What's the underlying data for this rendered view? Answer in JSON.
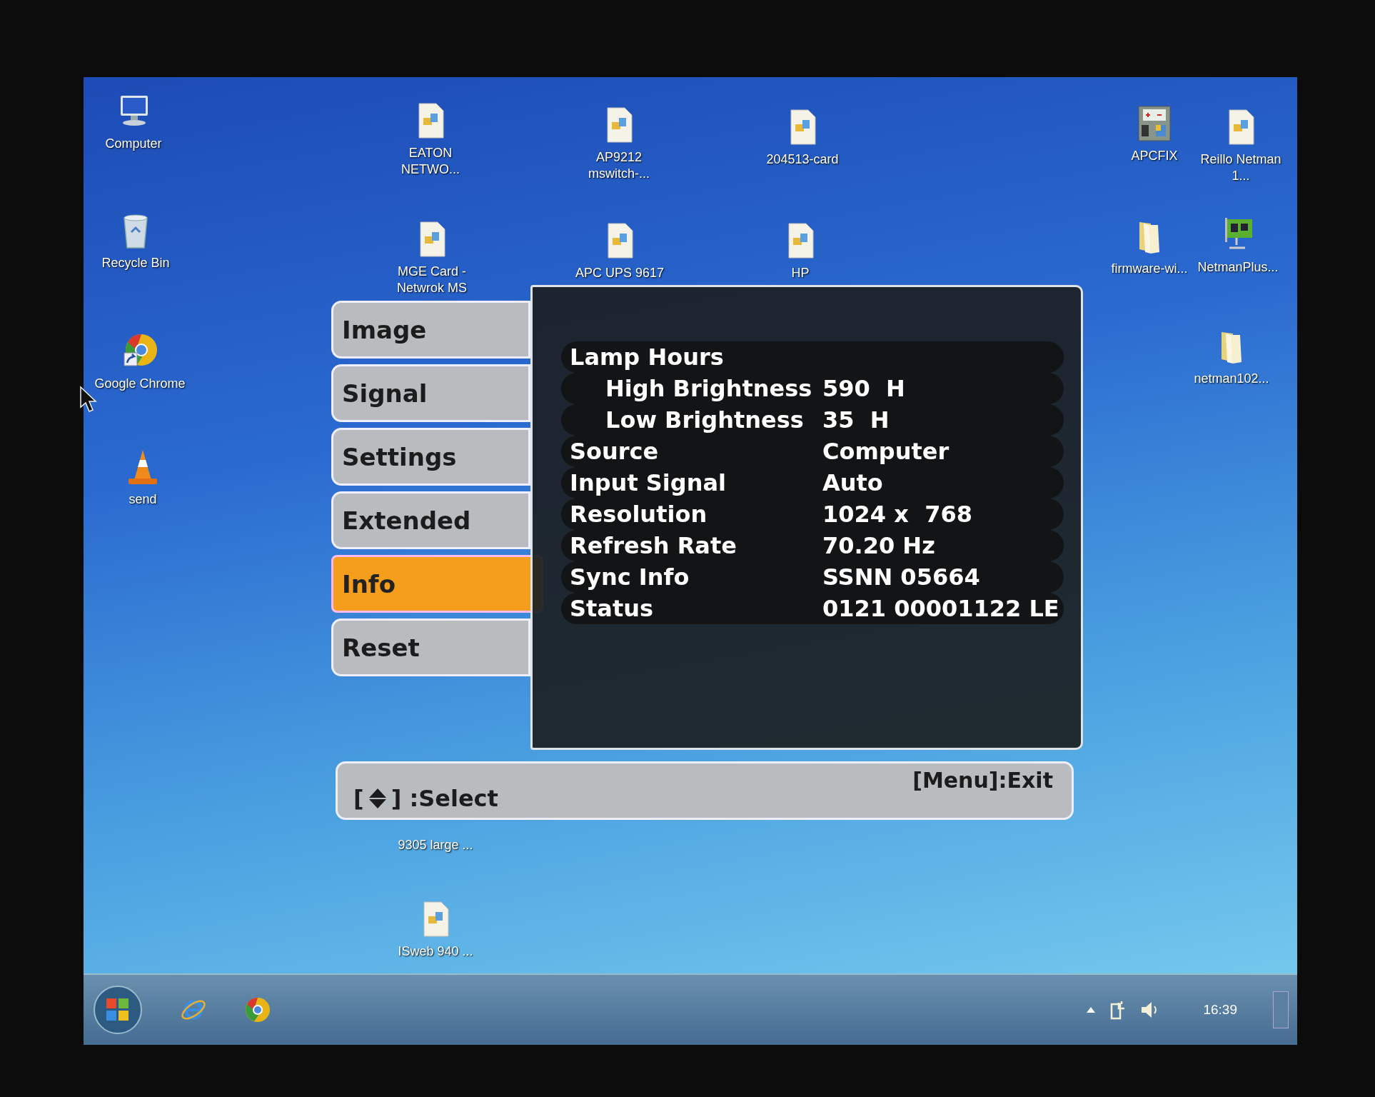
{
  "desktop_icons": [
    {
      "kind": "computer",
      "label": "Computer"
    },
    {
      "kind": "recycle",
      "label": "Recycle Bin"
    },
    {
      "kind": "chrome",
      "label": "Google Chrome"
    },
    {
      "kind": "cone",
      "label": "send"
    },
    {
      "kind": "doc",
      "label": "EATON NETWO..."
    },
    {
      "kind": "doc",
      "label": "AP9212 mswitch-..."
    },
    {
      "kind": "doc",
      "label": "204513-card"
    },
    {
      "kind": "doc",
      "label": "MGE Card - Netwrok MS"
    },
    {
      "kind": "doc",
      "label": "APC UPS 9617"
    },
    {
      "kind": "doc",
      "label": "HP"
    },
    {
      "kind": "apcfix",
      "label": "APCFIX"
    },
    {
      "kind": "doc",
      "label": "Reillo Netman 1..."
    },
    {
      "kind": "folder",
      "label": "firmware-wi..."
    },
    {
      "kind": "netcard",
      "label": "NetmanPlus..."
    },
    {
      "kind": "folder",
      "label": "netman102..."
    },
    {
      "kind": "hidden",
      "label": "9305 large ..."
    },
    {
      "kind": "doc",
      "label": "ISweb 940 ..."
    }
  ],
  "osd_menu": {
    "tabs": [
      {
        "label": "Image",
        "selected": false
      },
      {
        "label": "Signal",
        "selected": false
      },
      {
        "label": "Settings",
        "selected": false
      },
      {
        "label": "Extended",
        "selected": false
      },
      {
        "label": "Info",
        "selected": true
      },
      {
        "label": "Reset",
        "selected": false
      }
    ],
    "info": [
      {
        "label": "Lamp Hours",
        "children": [
          {
            "label": "High Brightness",
            "value": "590  H"
          },
          {
            "label": "Low Brightness",
            "value": "35  H"
          }
        ]
      },
      {
        "label": "Source",
        "value": "Computer"
      },
      {
        "label": "Input Signal",
        "value": "Auto"
      },
      {
        "label": "Resolution",
        "value": "1024 x  768"
      },
      {
        "label": "Refresh Rate",
        "value": "70.20 Hz"
      },
      {
        "label": "Sync Info",
        "value": "SSNN 05664"
      },
      {
        "label": "Status",
        "value": "0121 00001122 LE"
      }
    ],
    "help_bar": {
      "select_open": "[",
      "select_close": "] :Select",
      "exit": "[Menu]:Exit"
    }
  },
  "taskbar": {
    "clock": "16:39"
  }
}
